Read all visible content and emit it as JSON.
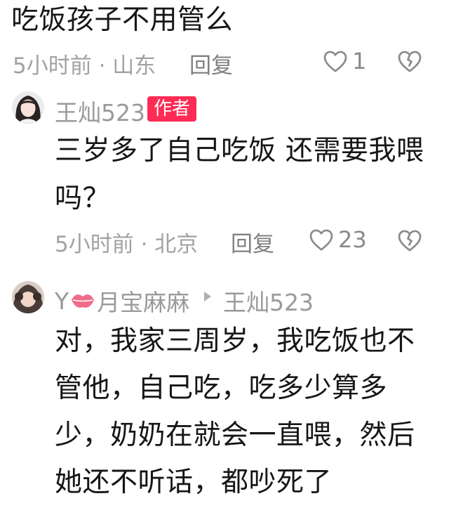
{
  "comment1": {
    "text": "吃饭孩子不用管么",
    "time_location": "5小时前 · 山东",
    "reply_label": "回复",
    "like_count": "1"
  },
  "comment2": {
    "author": "王灿523",
    "author_badge": "作者",
    "text_line1": "三岁多了自己吃饭 还需要我喂",
    "text_line2": "吗？",
    "time_location": "5小时前 · 北京",
    "reply_label": "回复",
    "like_count": "23"
  },
  "comment3": {
    "author_prefix": "Y",
    "author_suffix": "月宝麻麻",
    "reply_to": "王灿523",
    "text_line1": "对，我家三周岁，我吃饭也不",
    "text_line2": "管他，自己吃，吃多少算多",
    "text_line3": "少，奶奶在就会一直喂，然后",
    "text_line4": "她还不听话，都吵死了"
  },
  "colors": {
    "badge": "#fe2c55",
    "lips": "#f06b8a",
    "meta_gray": "#a2a2a2",
    "text": "#161616"
  },
  "icons": {
    "like": "heart-outline-icon",
    "dislike": "broken-heart-icon",
    "reply_arrow": "triangle-right-icon",
    "lips_emoji": "lips-icon"
  }
}
